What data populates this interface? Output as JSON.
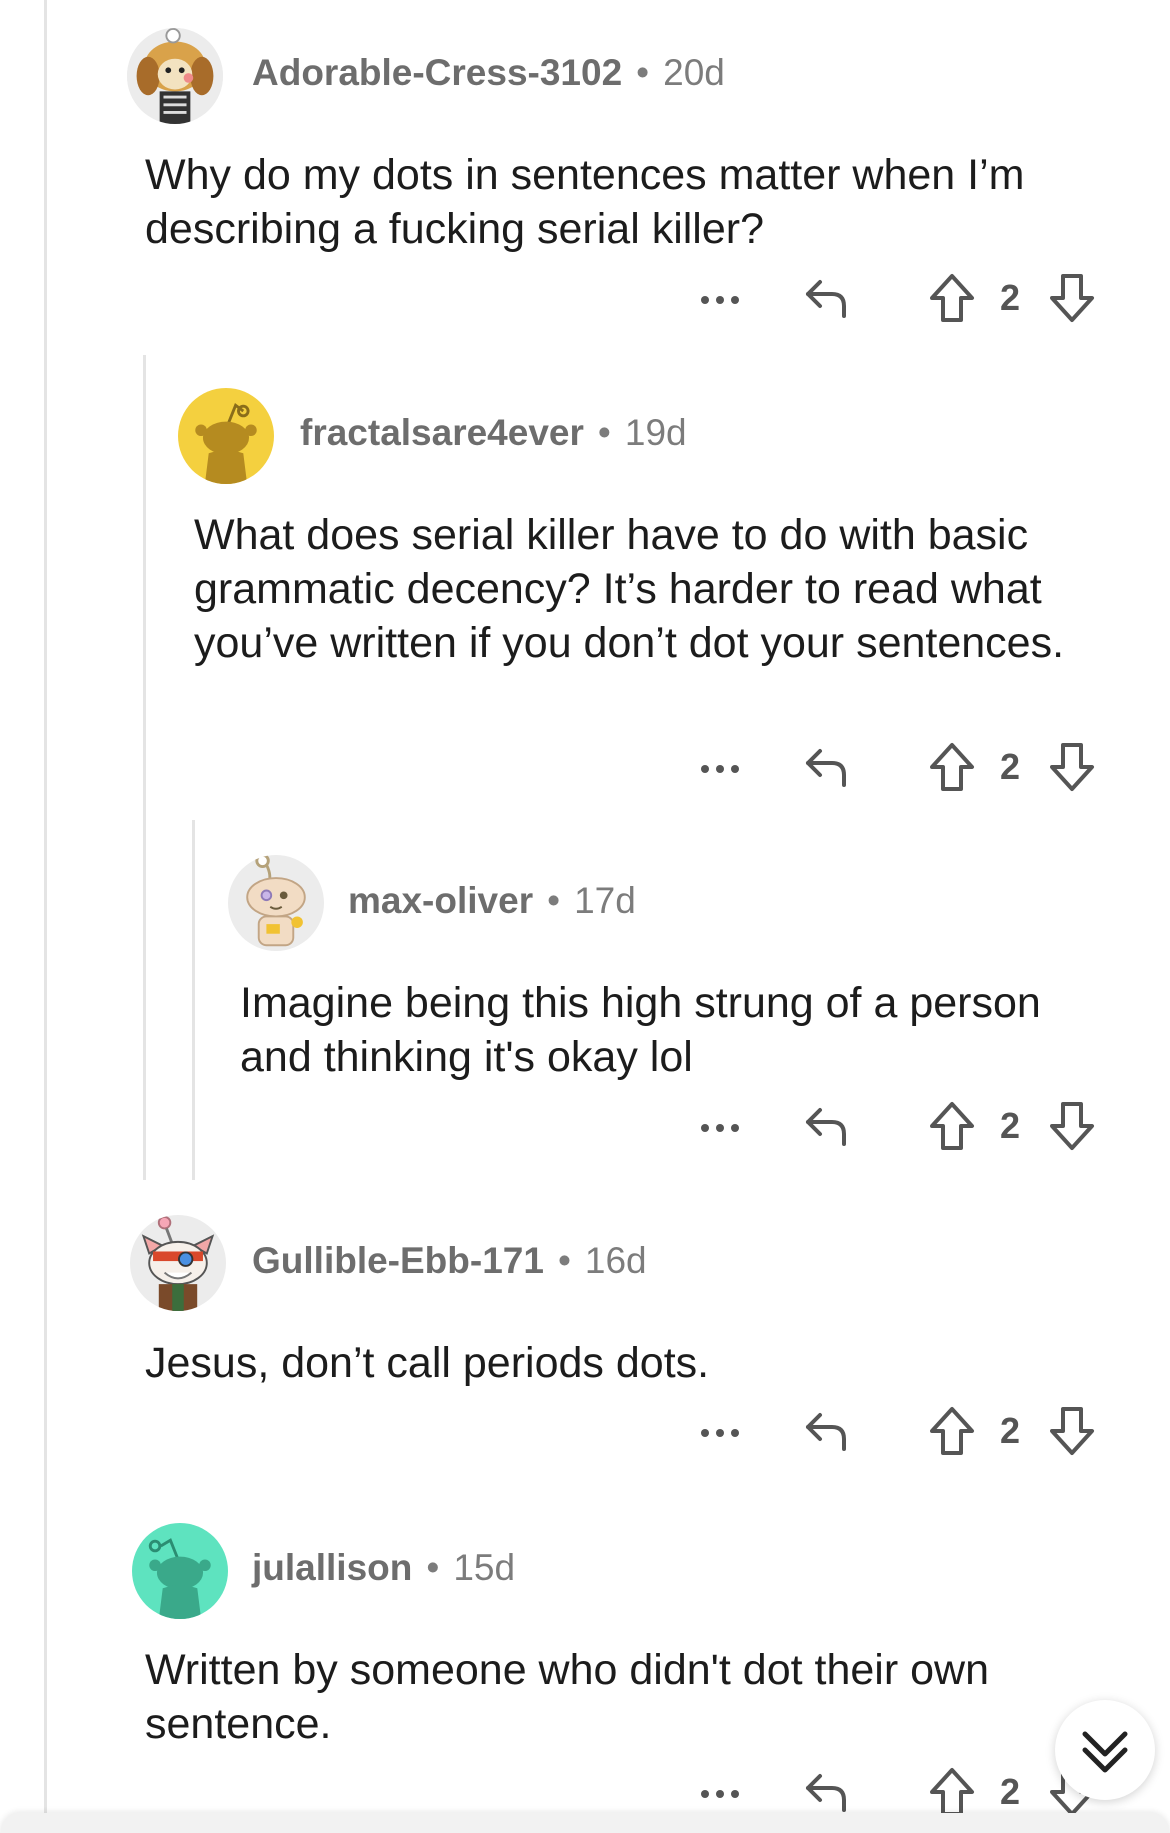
{
  "comments": [
    {
      "username": "Adorable-Cress-3102",
      "age": "20d",
      "body": "Why do my dots in sentences matter when I’m describing a fucking serial killer?",
      "score": "2",
      "avatar_icon": "dog-costume-avatar-icon"
    },
    {
      "username": "fractalsare4ever",
      "age": "19d",
      "body": "What does serial killer have to do with basic grammatic decency? It’s harder to read what you’ve written if you don’t dot your sentences.",
      "score": "2",
      "avatar_icon": "snoo-avatar-icon",
      "avatar_color": "#f4d03f"
    },
    {
      "username": "max-oliver",
      "age": "17d",
      "body": "Imagine being this high strung of a person and thinking it's okay lol",
      "score": "2",
      "avatar_icon": "snoo-character-avatar-icon"
    },
    {
      "username": "Gullible-Ebb-171",
      "age": "16d",
      "body": "Jesus, don’t call periods dots.",
      "score": "2",
      "avatar_icon": "cat-costume-avatar-icon"
    },
    {
      "username": "julallison",
      "age": "15d",
      "body": "Written by someone who didn't dot their own sentence.",
      "score": "2",
      "avatar_icon": "snoo-avatar-icon",
      "avatar_color": "#5ee3bf"
    }
  ],
  "separator": "•",
  "icons": {
    "more": "more-options-icon",
    "reply": "reply-icon",
    "upvote": "upvote-arrow-icon",
    "downvote": "downvote-arrow-icon",
    "jump": "double-chevron-down-icon"
  }
}
